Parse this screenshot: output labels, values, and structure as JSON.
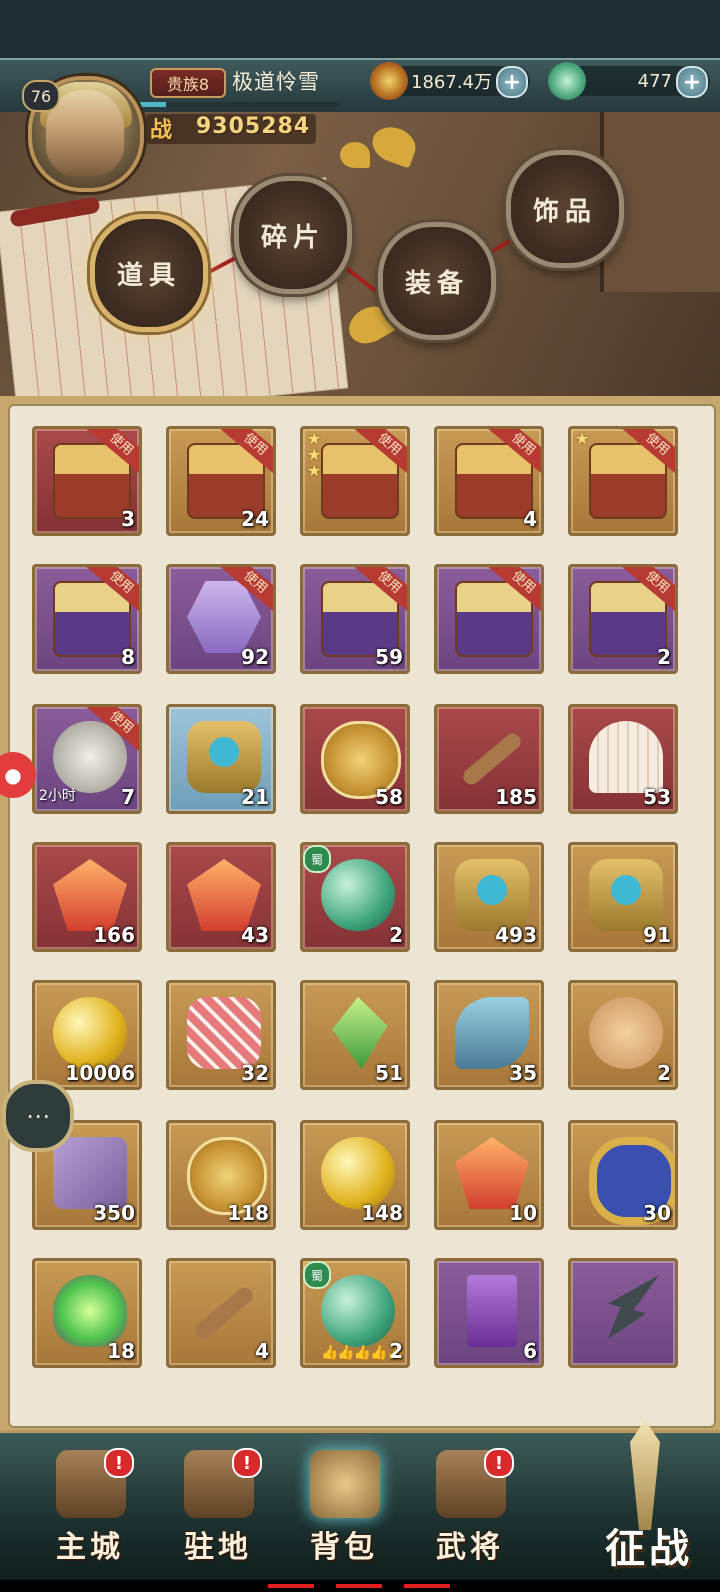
{
  "player": {
    "level": "76",
    "vip": "贵族8",
    "name": "极道怜雪",
    "power_label": "战",
    "power": "9305284",
    "xp_progress": 0.13
  },
  "currencies": {
    "coins": "1867.4万",
    "jade": "477"
  },
  "categories": [
    {
      "label": "道具",
      "active": true
    },
    {
      "label": "碎片",
      "active": false
    },
    {
      "label": "装备",
      "active": false
    },
    {
      "label": "饰品",
      "active": false
    }
  ],
  "use_label": "使用",
  "items": [
    {
      "icon": "red-treasure-chest-icon",
      "rarity": "red",
      "art": "chest",
      "count": "3",
      "use": true
    },
    {
      "icon": "orb-chest-icon",
      "rarity": "gold",
      "art": "chest",
      "count": "24",
      "use": true
    },
    {
      "icon": "star-chest-icon",
      "rarity": "gold",
      "art": "chest",
      "count": "",
      "use": true,
      "stars": "★\n★\n★"
    },
    {
      "icon": "gold-chest-icon",
      "rarity": "gold",
      "art": "chest",
      "count": "4",
      "use": true
    },
    {
      "icon": "star-gold-chest-icon",
      "rarity": "gold",
      "art": "chest",
      "count": "",
      "use": true,
      "stars": "★"
    },
    {
      "icon": "purple-chest-icon",
      "rarity": "purple",
      "art": "chest purple-chest",
      "count": "8",
      "use": true
    },
    {
      "icon": "mystery-hexagon-icon",
      "rarity": "purple",
      "art": "hex",
      "count": "92",
      "use": true
    },
    {
      "icon": "purple-orb-chest-icon",
      "rarity": "purple",
      "art": "chest purple-chest",
      "count": "59",
      "use": true
    },
    {
      "icon": "purple-silver-chest-icon",
      "rarity": "purple",
      "art": "chest purple-chest",
      "count": "",
      "use": true
    },
    {
      "icon": "purple-silver-chest-2-icon",
      "rarity": "purple",
      "art": "chest purple-chest",
      "count": "2",
      "use": true
    },
    {
      "icon": "sundial-icon",
      "rarity": "purple",
      "art": "sundial",
      "count": "7",
      "use": true,
      "timer": "2小时"
    },
    {
      "icon": "golden-emblem-icon",
      "rarity": "blue",
      "art": "emblem",
      "count": "21",
      "use": false
    },
    {
      "icon": "gold-coin-icon",
      "rarity": "red",
      "art": "coin",
      "count": "58",
      "use": false
    },
    {
      "icon": "horn-icon",
      "rarity": "red",
      "art": "stick",
      "count": "185",
      "use": false
    },
    {
      "icon": "shell-icon",
      "rarity": "red",
      "art": "shell",
      "count": "53",
      "use": false
    },
    {
      "icon": "pink-crystal-figure-icon",
      "rarity": "red",
      "art": "gem",
      "count": "166",
      "use": false
    },
    {
      "icon": "fire-gem-icon",
      "rarity": "red",
      "art": "gem",
      "count": "43",
      "use": false
    },
    {
      "icon": "green-orb-icon",
      "rarity": "red",
      "art": "orb",
      "count": "2",
      "use": false,
      "badge": "蜀"
    },
    {
      "icon": "sword-emblem-icon",
      "rarity": "gold",
      "art": "emblem",
      "count": "493",
      "use": false
    },
    {
      "icon": "helmet-emblem-icon",
      "rarity": "gold",
      "art": "emblem",
      "count": "91",
      "use": false
    },
    {
      "icon": "golden-pearl-icon",
      "rarity": "gold",
      "art": "pearl",
      "count": "10006",
      "use": false
    },
    {
      "icon": "meat-icon",
      "rarity": "gold",
      "art": "meat",
      "count": "32",
      "use": false
    },
    {
      "icon": "green-crystal-icon",
      "rarity": "gold",
      "art": "crystal",
      "count": "51",
      "use": false
    },
    {
      "icon": "fish-icon",
      "rarity": "gold",
      "art": "fish",
      "count": "35",
      "use": false
    },
    {
      "icon": "bread-icon",
      "rarity": "gold",
      "art": "bread",
      "count": "2",
      "use": false
    },
    {
      "icon": "purple-scroll-icon",
      "rarity": "gold",
      "art": "scroll",
      "count": "350",
      "use": false
    },
    {
      "icon": "jade-disc-icon",
      "rarity": "gold",
      "art": "coin",
      "count": "118",
      "use": false
    },
    {
      "icon": "orange-orb-icon",
      "rarity": "gold",
      "art": "pearl",
      "count": "148",
      "use": false
    },
    {
      "icon": "amber-crystal-icon",
      "rarity": "gold",
      "art": "gem",
      "count": "10",
      "use": false
    },
    {
      "icon": "armillary-sphere-icon",
      "rarity": "gold",
      "art": "ring",
      "count": "30",
      "use": false
    },
    {
      "icon": "green-flame-icon",
      "rarity": "gold",
      "art": "fire",
      "count": "18",
      "use": false
    },
    {
      "icon": "wooden-branch-icon",
      "rarity": "gold",
      "art": "stick",
      "count": "4",
      "use": false
    },
    {
      "icon": "green-orb-2-icon",
      "rarity": "gold",
      "art": "orb",
      "count": "2",
      "use": false,
      "badge": "蜀",
      "star_row": "👍👍👍👍👍"
    },
    {
      "icon": "purple-talisman-icon",
      "rarity": "purple",
      "art": "tag",
      "count": "6",
      "use": false
    },
    {
      "icon": "spear-head-icon",
      "rarity": "purple",
      "art": "spear",
      "count": "",
      "use": false
    }
  ],
  "nav": [
    {
      "label": "主城",
      "alert": true,
      "active": false
    },
    {
      "label": "驻地",
      "alert": true,
      "active": false
    },
    {
      "label": "背包",
      "alert": false,
      "active": true
    },
    {
      "label": "武将",
      "alert": true,
      "active": false
    }
  ],
  "battle_label": "征战",
  "colors": {
    "accent": "#c6a86e",
    "alert": "#d82a2a"
  }
}
